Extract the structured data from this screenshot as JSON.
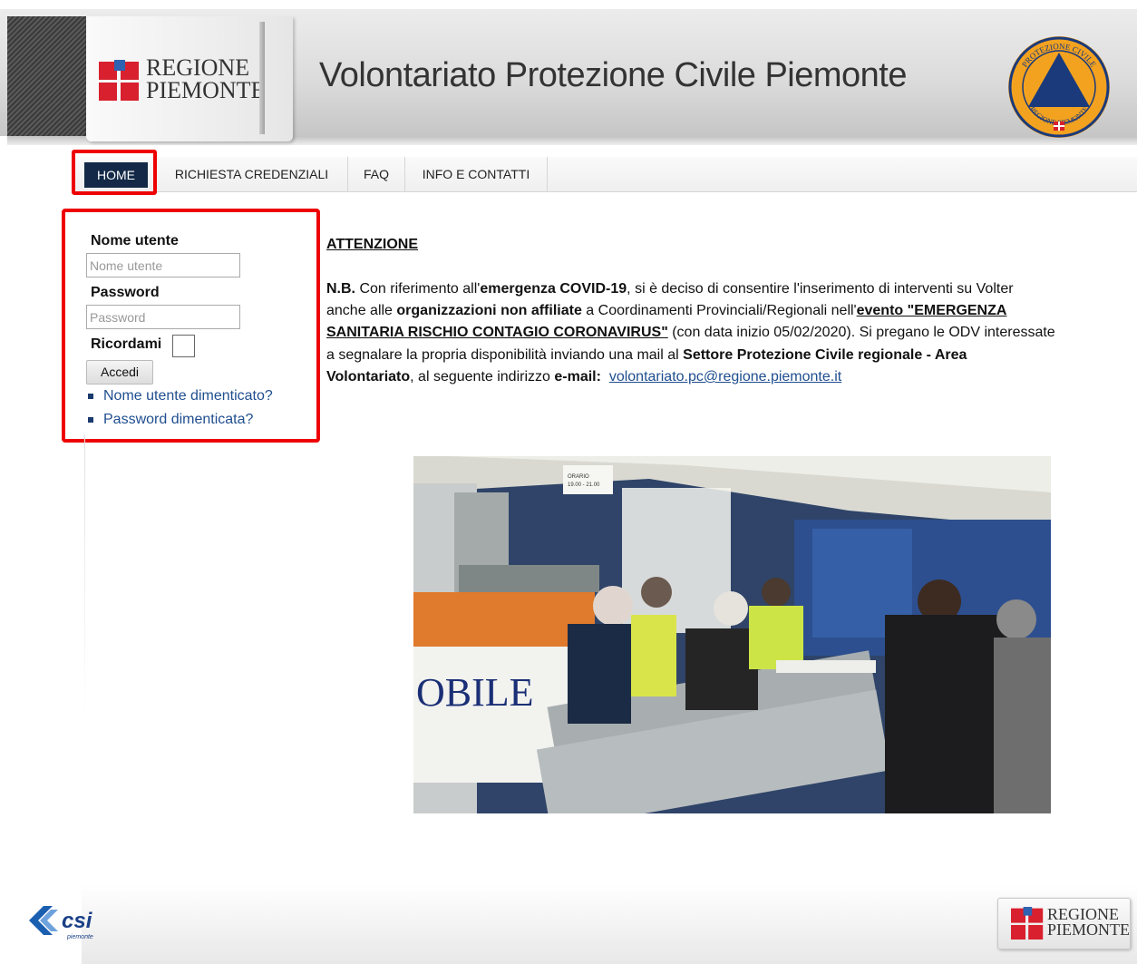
{
  "header": {
    "logo_line1": "REGIONE",
    "logo_line2": "PIEMONTE",
    "site_title": "Volontariato Protezione Civile Piemonte",
    "emblem_top_text": "PROTEZIONE CIVILE",
    "emblem_bottom_text": "REGIONE PIEMONTE"
  },
  "nav": {
    "items": [
      "HOME",
      "RICHIESTA CREDENZIALI",
      "FAQ",
      "INFO E CONTATTI"
    ],
    "active": "HOME"
  },
  "login": {
    "username_label": "Nome utente",
    "username_placeholder": "Nome utente",
    "password_label": "Password",
    "password_placeholder": "Password",
    "remember_label": "Ricordami",
    "submit_label": "Accedi",
    "forgot_username": "Nome utente dimenticato?",
    "forgot_password": "Password dimenticata?"
  },
  "content": {
    "heading": "ATTENZIONE",
    "l1_nb": "N.B.",
    "l1_a": " Con riferimento all'",
    "l1_b": "emergenza COVID-19",
    "l1_c": ", si è deciso di consentire l'inserimento di interventi su Volter",
    "l2_a": "anche alle ",
    "l2_b": "organizzazioni non affiliate",
    "l2_c": " a Coordinamenti Provinciali/Regionali nell'",
    "l2_d": "evento \"EMERGENZA",
    "l3_a": "SANITARIA RISCHIO CONTAGIO CORONAVIRUS\"",
    "l3_b": " (con data inizio 05/02/2020). Si pregano le ODV interessate",
    "l4_a": "a segnalare la propria disponibilità inviando una mail al ",
    "l4_b": "Settore Protezione Civile regionale - Area",
    "l5_a": "Volontariato",
    "l5_b": ", al seguente indirizzo ",
    "l5_c": "e-mail:",
    "email": "volontariato.pc@regione.piemonte.it"
  },
  "photo": {
    "truck_text": "OBILE",
    "sign_line1": "ORARIO",
    "sign_line2": "19.00 - 21.00"
  },
  "footer": {
    "csi_text": "csi",
    "csi_sub": "piemonte",
    "rp_line1": "REGIONE",
    "rp_line2": "PIEMONTE"
  }
}
